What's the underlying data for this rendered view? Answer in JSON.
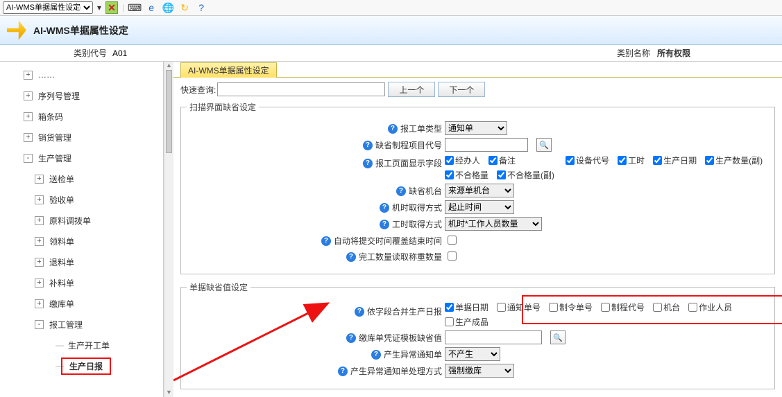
{
  "topbar": {
    "doc_selector": "AI-WMS单据属性设定(\\",
    "icons": [
      "close",
      "keyboard",
      "ie",
      "edge",
      "refresh",
      "help"
    ]
  },
  "titlebar": {
    "title": "AI-WMS单据属性设定"
  },
  "filterbar": {
    "code_label": "类别代号",
    "code_value": "A01",
    "name_label": "类别名称",
    "name_value": "所有权限"
  },
  "tree": [
    {
      "level": 1,
      "exp": "+",
      "label": "……"
    },
    {
      "level": 1,
      "exp": "+",
      "label": "序列号管理"
    },
    {
      "level": 1,
      "exp": "+",
      "label": "箱条码"
    },
    {
      "level": 1,
      "exp": "+",
      "label": "销货管理"
    },
    {
      "level": 1,
      "exp": "-",
      "label": "生产管理"
    },
    {
      "level": 2,
      "exp": "+",
      "label": "送检单"
    },
    {
      "level": 2,
      "exp": "+",
      "label": "验收单"
    },
    {
      "level": 2,
      "exp": "+",
      "label": "原料调拨单"
    },
    {
      "level": 2,
      "exp": "+",
      "label": "领料单"
    },
    {
      "level": 2,
      "exp": "+",
      "label": "退料单"
    },
    {
      "level": 2,
      "exp": "+",
      "label": "补料单"
    },
    {
      "level": 2,
      "exp": "+",
      "label": "缴库单"
    },
    {
      "level": 2,
      "exp": "-",
      "label": "报工管理"
    },
    {
      "level": 3,
      "leaf": true,
      "label": "生产开工单"
    },
    {
      "level": 3,
      "leaf": true,
      "label": "生产日报",
      "selected": true
    }
  ],
  "tab_label": "AI-WMS单据属性设定",
  "search": {
    "label": "快速查询:",
    "value": "",
    "prev": "上一个",
    "next": "下一个"
  },
  "group1": {
    "legend": "扫描界面缺省设定",
    "rows": {
      "report_type": {
        "label": "报工单类型",
        "value": "通知单"
      },
      "default_proc": {
        "label": "缺省制程项目代号",
        "value": ""
      },
      "display_fields": {
        "label": "报工页面显示字段",
        "checks_row1": [
          {
            "label": "经办人",
            "v": true
          },
          {
            "label": "备注",
            "v": true
          },
          {
            "label": "设备代号",
            "v": true
          },
          {
            "label": "工时",
            "v": true
          },
          {
            "label": "生产日期",
            "v": true
          },
          {
            "label": "生产数量(副)",
            "v": true
          }
        ],
        "checks_row2": [
          {
            "label": "不合格量",
            "v": true
          },
          {
            "label": "不合格量(副)",
            "v": true
          }
        ]
      },
      "default_machine": {
        "label": "缺省机台",
        "value": "来源单机台"
      },
      "machine_hour_src": {
        "label": "机时取得方式",
        "value": "起止时间"
      },
      "work_hour_src": {
        "label": "工时取得方式",
        "value": "机时*工作人员数量"
      },
      "auto_overwrite": {
        "label": "自动将提交时间覆盖结束时间",
        "v": false
      },
      "read_weigh": {
        "label": "完工数量读取称重数量",
        "v": false
      }
    }
  },
  "group2": {
    "legend": "单据缺省值设定",
    "rows": {
      "merge_fields": {
        "label": "依字段合并生产日报",
        "checks": [
          {
            "label": "单据日期",
            "v": true
          },
          {
            "label": "通知单号",
            "v": false
          },
          {
            "label": "制令单号",
            "v": false
          },
          {
            "label": "制程代号",
            "v": false
          },
          {
            "label": "机台",
            "v": false
          },
          {
            "label": "作业人员",
            "v": false
          },
          {
            "label": "生产成品",
            "v": false
          }
        ]
      },
      "warehouse_tpl": {
        "label": "缴库单凭证模板缺省值",
        "value": ""
      },
      "make_exception": {
        "label": "产生异常通知单",
        "value": "不产生"
      },
      "exception_proc": {
        "label": "产生异常通知单处理方式",
        "value": "强制缴库"
      }
    }
  }
}
